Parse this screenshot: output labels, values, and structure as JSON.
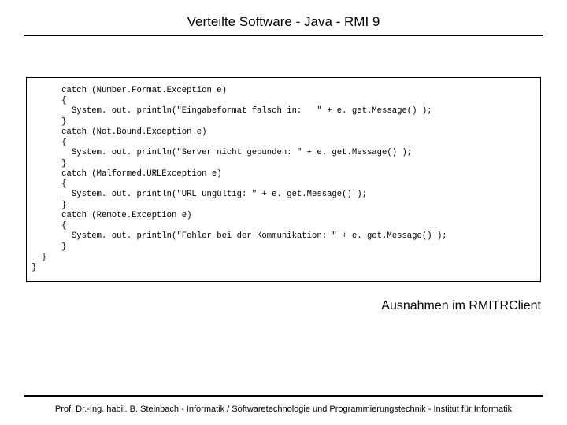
{
  "header": {
    "title": "Verteilte Software - Java - RMI 9"
  },
  "code": {
    "lines": [
      "      catch (Number.Format.Exception e)",
      "      {",
      "        System. out. println(\"Eingabeformat falsch in:   \" + e. get.Message() );",
      "      }",
      "      catch (Not.Bound.Exception e)",
      "      {",
      "        System. out. println(\"Server nicht gebunden: \" + e. get.Message() );",
      "      }",
      "      catch (Malformed.URLException e)",
      "      {",
      "        System. out. println(\"URL ungültig: \" + e. get.Message() );",
      "      }",
      "      catch (Remote.Exception e)",
      "      {",
      "        System. out. println(\"Fehler bei der Kommunikation: \" + e. get.Message() );",
      "      }",
      "  }",
      "}"
    ]
  },
  "caption": {
    "text": "Ausnahmen im RMITRClient"
  },
  "footer": {
    "text": "Prof. Dr.-Ing. habil. B. Steinbach - Informatik / Softwaretechnologie und Programmierungstechnik - Institut für Informatik"
  }
}
